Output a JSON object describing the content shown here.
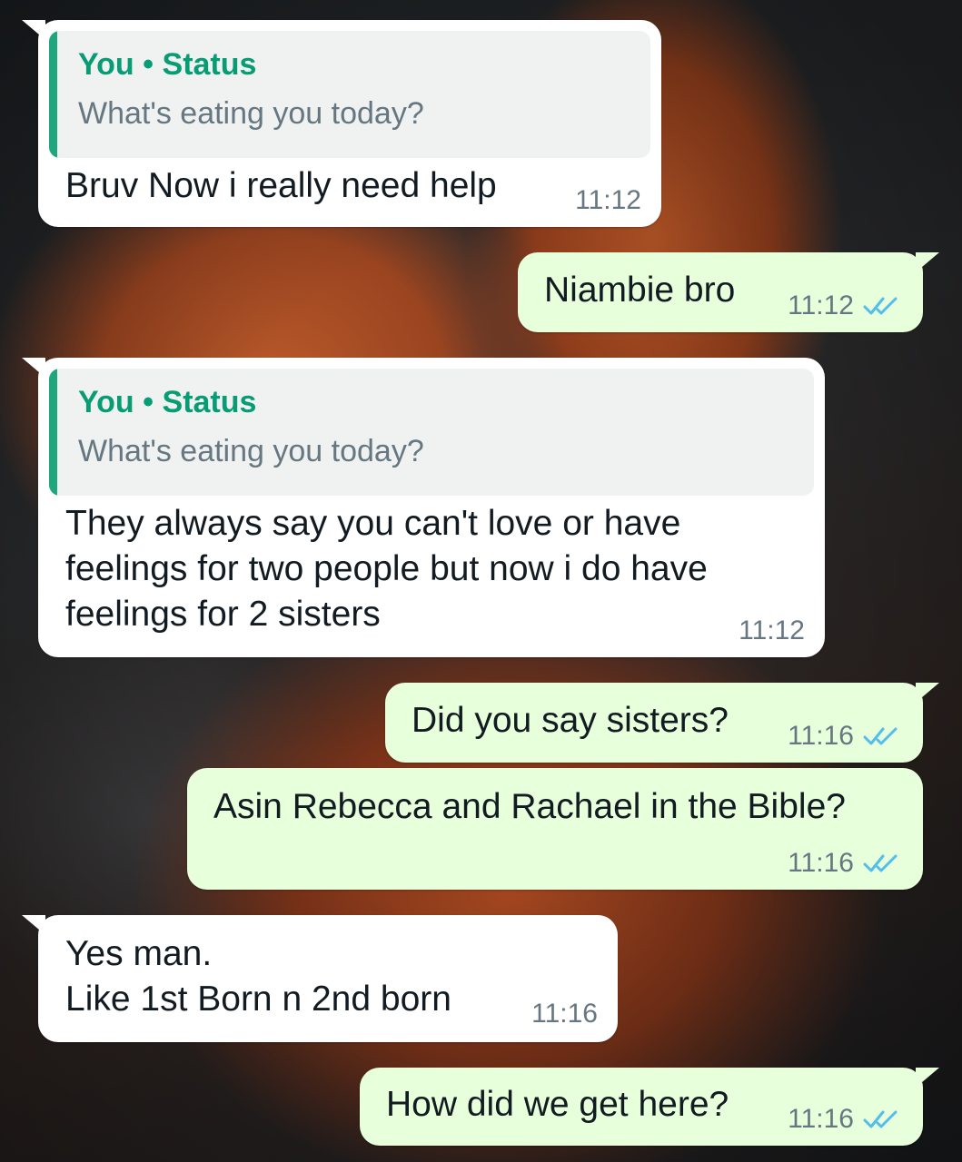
{
  "messages": [
    {
      "direction": "incoming",
      "quote": {
        "author": "You",
        "separator": "•",
        "source": "Status",
        "text": "What's eating you today?"
      },
      "text": "Bruv Now i really need help",
      "time": "11:12"
    },
    {
      "direction": "outgoing",
      "text": "Niambie bro",
      "time": "11:12",
      "read": true
    },
    {
      "direction": "incoming",
      "quote": {
        "author": "You",
        "separator": "•",
        "source": "Status",
        "text": "What's eating you today?"
      },
      "text": "They always say you can't love or have\nfeelings for two people but now i do have\nfeelings for 2 sisters",
      "time": "11:12"
    },
    {
      "direction": "outgoing",
      "text": "Did you say sisters?",
      "time": "11:16",
      "read": true
    },
    {
      "direction": "outgoing",
      "text": "Asin Rebecca and Rachael in the Bible?",
      "time": "11:16",
      "read": true
    },
    {
      "direction": "incoming",
      "text": "Yes man.\nLike 1st Born n 2nd born",
      "time": "11:16"
    },
    {
      "direction": "outgoing",
      "text": "How did we get here?",
      "time": "11:16",
      "read": true
    }
  ],
  "icons": {
    "read_receipt": "double-check-icon"
  },
  "colors": {
    "incoming_bubble": "#ffffff",
    "outgoing_bubble": "#e7ffdb",
    "quote_accent": "#1fa67d",
    "quote_author": "#089c74",
    "read_tick": "#53bdeb",
    "timestamp": "#667781"
  }
}
